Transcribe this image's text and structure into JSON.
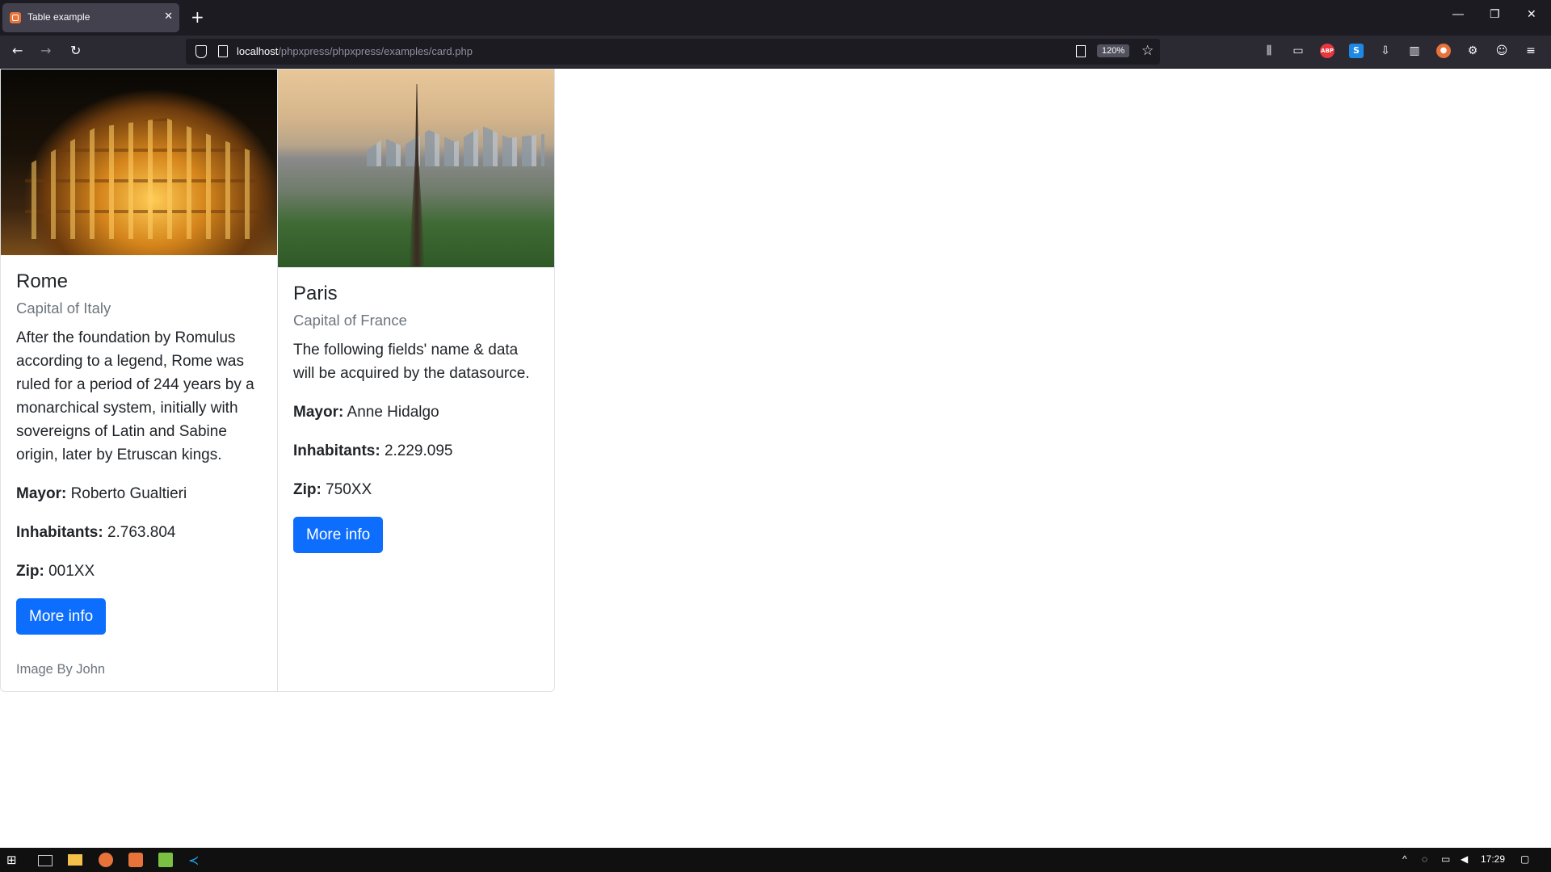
{
  "browser": {
    "tab_title": "Table example",
    "url_host": "localhost",
    "url_path": "/phpxpress/phpxpress/examples/card.php",
    "zoom": "120%"
  },
  "cards": [
    {
      "title": "Rome",
      "subtitle": "Capital of Italy",
      "text": "After the foundation by Romulus according to a legend, Rome was ruled for a period of 244 years by a monarchical system, initially with sovereigns of Latin and Sabine origin, later by Etruscan kings.",
      "mayor_label": "Mayor:",
      "mayor": "Roberto Gualtieri",
      "inhabitants_label": "Inhabitants:",
      "inhabitants": "2.763.804",
      "zip_label": "Zip:",
      "zip": "001XX",
      "button": "More info",
      "footer": "Image By John"
    },
    {
      "title": "Paris",
      "subtitle": "Capital of France",
      "text": "The following fields' name & data will be acquired by the datasource.",
      "mayor_label": "Mayor:",
      "mayor": "Anne Hidalgo",
      "inhabitants_label": "Inhabitants:",
      "inhabitants": "2.229.095",
      "zip_label": "Zip:",
      "zip": "750XX",
      "button": "More info"
    }
  ],
  "taskbar": {
    "time": "17:29"
  },
  "colors": {
    "button_bg": "#0d6efd",
    "muted": "#6c757d",
    "chrome_dark": "#1c1b22"
  }
}
